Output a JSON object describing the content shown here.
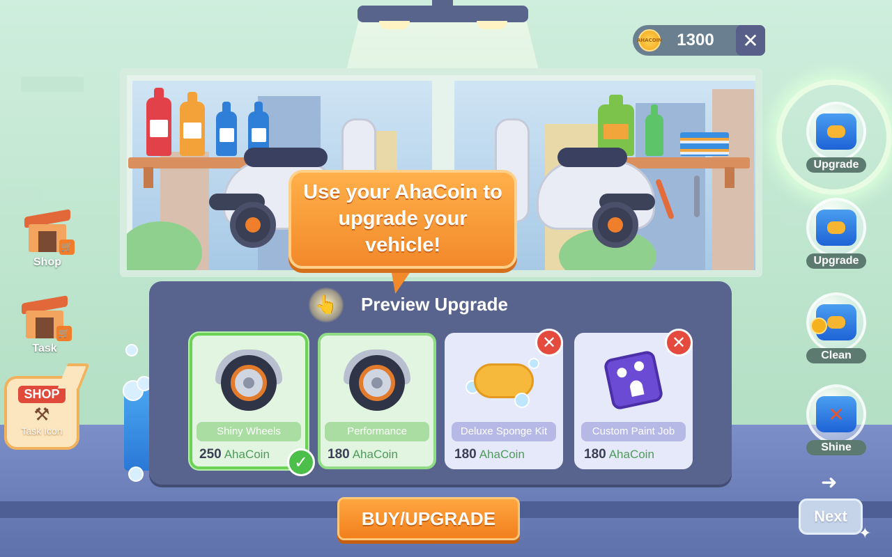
{
  "hud": {
    "coin_icon_text": "AHACOIN",
    "coin_amount": "1300",
    "close_label": "✕"
  },
  "left_nav": {
    "items": [
      {
        "label": "Shop",
        "icon": "shop-icon"
      },
      {
        "label": "Task",
        "icon": "task-icon"
      }
    ],
    "shop_badge": {
      "sign": "SHOP",
      "tools": "⚒",
      "label": "Task Icon"
    }
  },
  "right_nav": {
    "items": [
      {
        "label": "Upgrade",
        "icon": "bucket-sponge-icon",
        "active": true
      },
      {
        "label": "Upgrade",
        "icon": "bucket-sponge-icon",
        "active": false
      },
      {
        "label": "Clean",
        "icon": "bucket-sponge-icon",
        "active": false
      },
      {
        "label": "Shine",
        "icon": "bucket-wrench-icon",
        "active": false
      }
    ],
    "next_arrow": "➜",
    "next_label": "Next"
  },
  "tooltip": {
    "text": "Use your AhaCoin to upgrade your vehicle!"
  },
  "panel": {
    "title": "Preview Upgrade",
    "cards": [
      {
        "name": "Shiny Wheels",
        "price": "250",
        "unit": "AhaCoin",
        "state": "selected",
        "icon": "wheel-icon"
      },
      {
        "name": "Performance",
        "price": "180",
        "unit": "AhaCoin",
        "state": "available",
        "icon": "wheel-icon"
      },
      {
        "name": "Deluxe Sponge Kit",
        "price": "180",
        "unit": "AhaCoin",
        "state": "locked",
        "icon": "sponge-icon"
      },
      {
        "name": "Custom Paint Job",
        "price": "180",
        "unit": "AhaCoin",
        "state": "locked",
        "icon": "paint-icon"
      }
    ],
    "check_mark": "✓",
    "locked_mark": "✕"
  },
  "buy_button": "BUY/UPGRADE",
  "colors": {
    "accent_orange": "#f2892b",
    "panel_bg": "#59648e",
    "selected_green": "#6cd256",
    "locked_red": "#e44a3e",
    "wall_green": "#bfe6cf"
  }
}
